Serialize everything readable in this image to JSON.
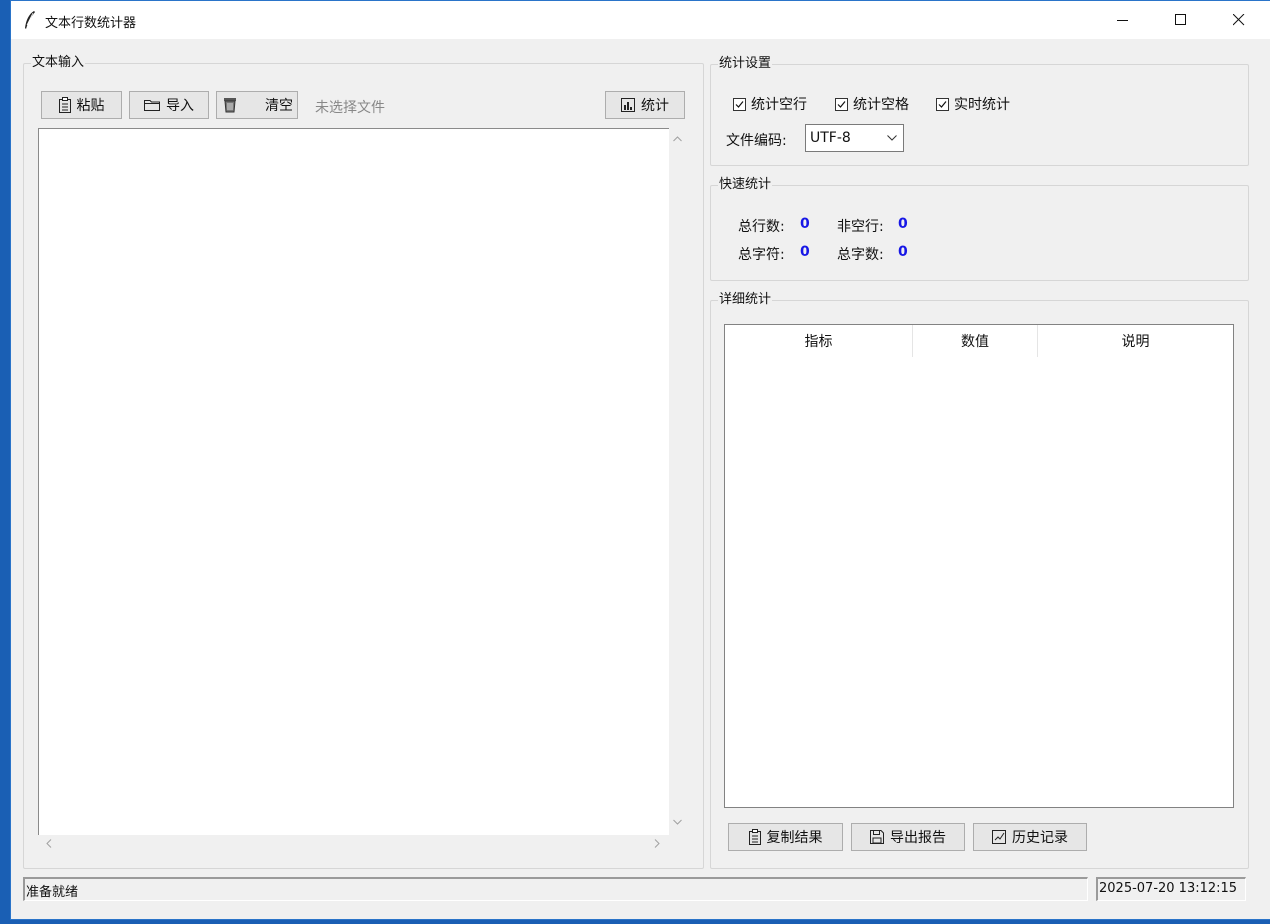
{
  "window": {
    "title": "文本行数统计器"
  },
  "text_input": {
    "group_title": "文本输入",
    "paste_label": "粘贴",
    "import_label": "导入",
    "clear_label": "清空",
    "file_status": "未选择文件",
    "stats_label": "统计",
    "text_value": ""
  },
  "settings": {
    "group_title": "统计设置",
    "count_empty_lines": {
      "label": "统计空行",
      "checked": true
    },
    "count_spaces": {
      "label": "统计空格",
      "checked": true
    },
    "realtime": {
      "label": "实时统计",
      "checked": true
    },
    "encoding_label": "文件编码:",
    "encoding_value": "UTF-8"
  },
  "quick_stats": {
    "group_title": "快速统计",
    "total_lines_label": "总行数:",
    "total_lines_value": "0",
    "non_empty_label": "非空行:",
    "non_empty_value": "0",
    "total_chars_label": "总字符:",
    "total_chars_value": "0",
    "total_words_label": "总字数:",
    "total_words_value": "0"
  },
  "detail_stats": {
    "group_title": "详细统计",
    "columns": [
      "指标",
      "数值",
      "说明"
    ],
    "rows": [],
    "copy_label": "复制结果",
    "export_label": "导出报告",
    "history_label": "历史记录"
  },
  "statusbar": {
    "status_text": "准备就绪",
    "datetime": "2025-07-20 13:12:15"
  },
  "colors": {
    "accent_value": "#1717e6",
    "window_bg": "#f0f0f0",
    "desktop": "#1a5fb4"
  }
}
